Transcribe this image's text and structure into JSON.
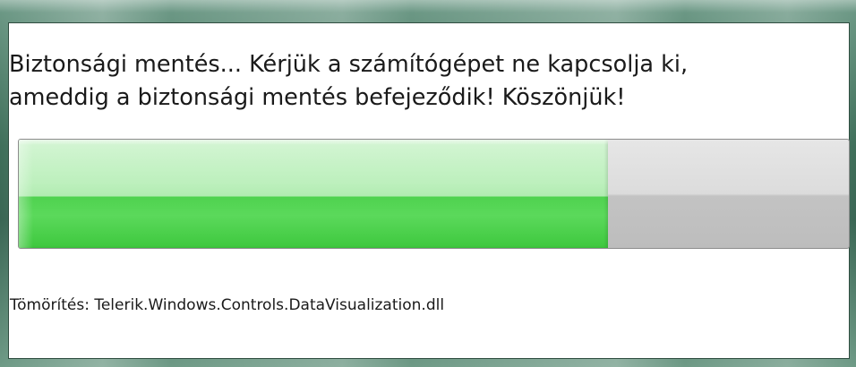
{
  "dialog": {
    "message": "Biztonsági mentés... Kérjük a számítógépet ne kapcsolja ki,\nameddig a biztonsági mentés befejeződik! Köszönjük!",
    "progress": {
      "percent": 71
    },
    "status_text": "Tömörítés: Telerik.Windows.Controls.DataVisualization.dll"
  },
  "colors": {
    "frame": "#3f6f5a",
    "progress_fill": "#4fd24f",
    "progress_track": "#c3c3c3",
    "text": "#1a1a1a"
  }
}
